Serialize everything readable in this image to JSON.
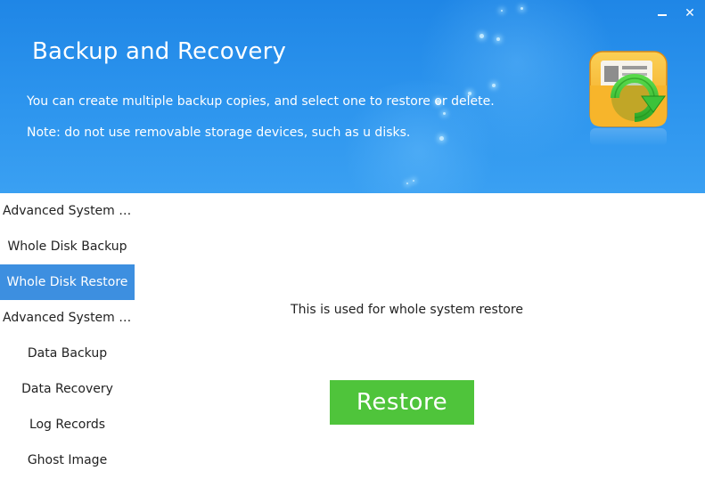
{
  "window": {
    "minimize_label": "",
    "close_label": "✕"
  },
  "banner": {
    "title": "Backup and Recovery",
    "description_line1": "You can create multiple backup copies, and select one to restore or delete.",
    "description_line2": "Note: do not use removable storage devices, such as u disks.",
    "app_icon": "backup-restore-folder-icon",
    "colors": {
      "background": "#2d95ee",
      "icon_folder": "#f7b52b",
      "icon_arrow": "#3cc23a"
    }
  },
  "sidebar": {
    "items": [
      {
        "label": "Advanced System Ba…",
        "active": false,
        "type": "section"
      },
      {
        "label": "Whole Disk Backup",
        "active": false,
        "type": "item"
      },
      {
        "label": "Whole Disk Restore",
        "active": true,
        "type": "item"
      },
      {
        "label": "Advanced System R…",
        "active": false,
        "type": "section"
      },
      {
        "label": "Data Backup",
        "active": false,
        "type": "item"
      },
      {
        "label": "Data Recovery",
        "active": false,
        "type": "item"
      },
      {
        "label": "Log Records",
        "active": false,
        "type": "item"
      },
      {
        "label": "Ghost Image",
        "active": false,
        "type": "item"
      }
    ],
    "active_color": "#3d8fe0"
  },
  "main": {
    "info_text": "This is used for whole system restore",
    "restore_button_label": "Restore",
    "restore_button_color": "#4fc43b"
  }
}
